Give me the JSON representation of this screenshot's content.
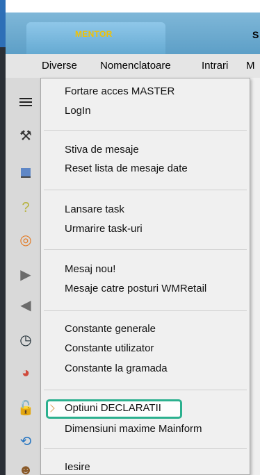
{
  "window": {
    "active_tab": "MENTOR",
    "next_tab_partial": "S"
  },
  "menubar": {
    "items": [
      {
        "label": "Diverse"
      },
      {
        "label": "Nomenclatoare"
      },
      {
        "label": "Intrari"
      },
      {
        "label": "M"
      }
    ]
  },
  "dropdown": {
    "groups": [
      [
        "Fortare acces MASTER",
        "LogIn"
      ],
      [
        "Stiva de mesaje",
        "Reset lista de mesaje date"
      ],
      [
        "Lansare task",
        "Urmarire task-uri"
      ],
      [
        "Mesaj nou!",
        "Mesaje catre posturi WMRetail"
      ],
      [
        "Constante generale",
        "Constante utilizator",
        "Constante la gramada"
      ],
      [
        "Optiuni DECLARATII",
        "Dimensiuni maxime Mainform"
      ],
      [
        "Iesire"
      ]
    ]
  },
  "colors": {
    "tab_text": "#F2C200",
    "highlight_outline": "#2BB08E",
    "menu_background": "#F0F0F0"
  }
}
